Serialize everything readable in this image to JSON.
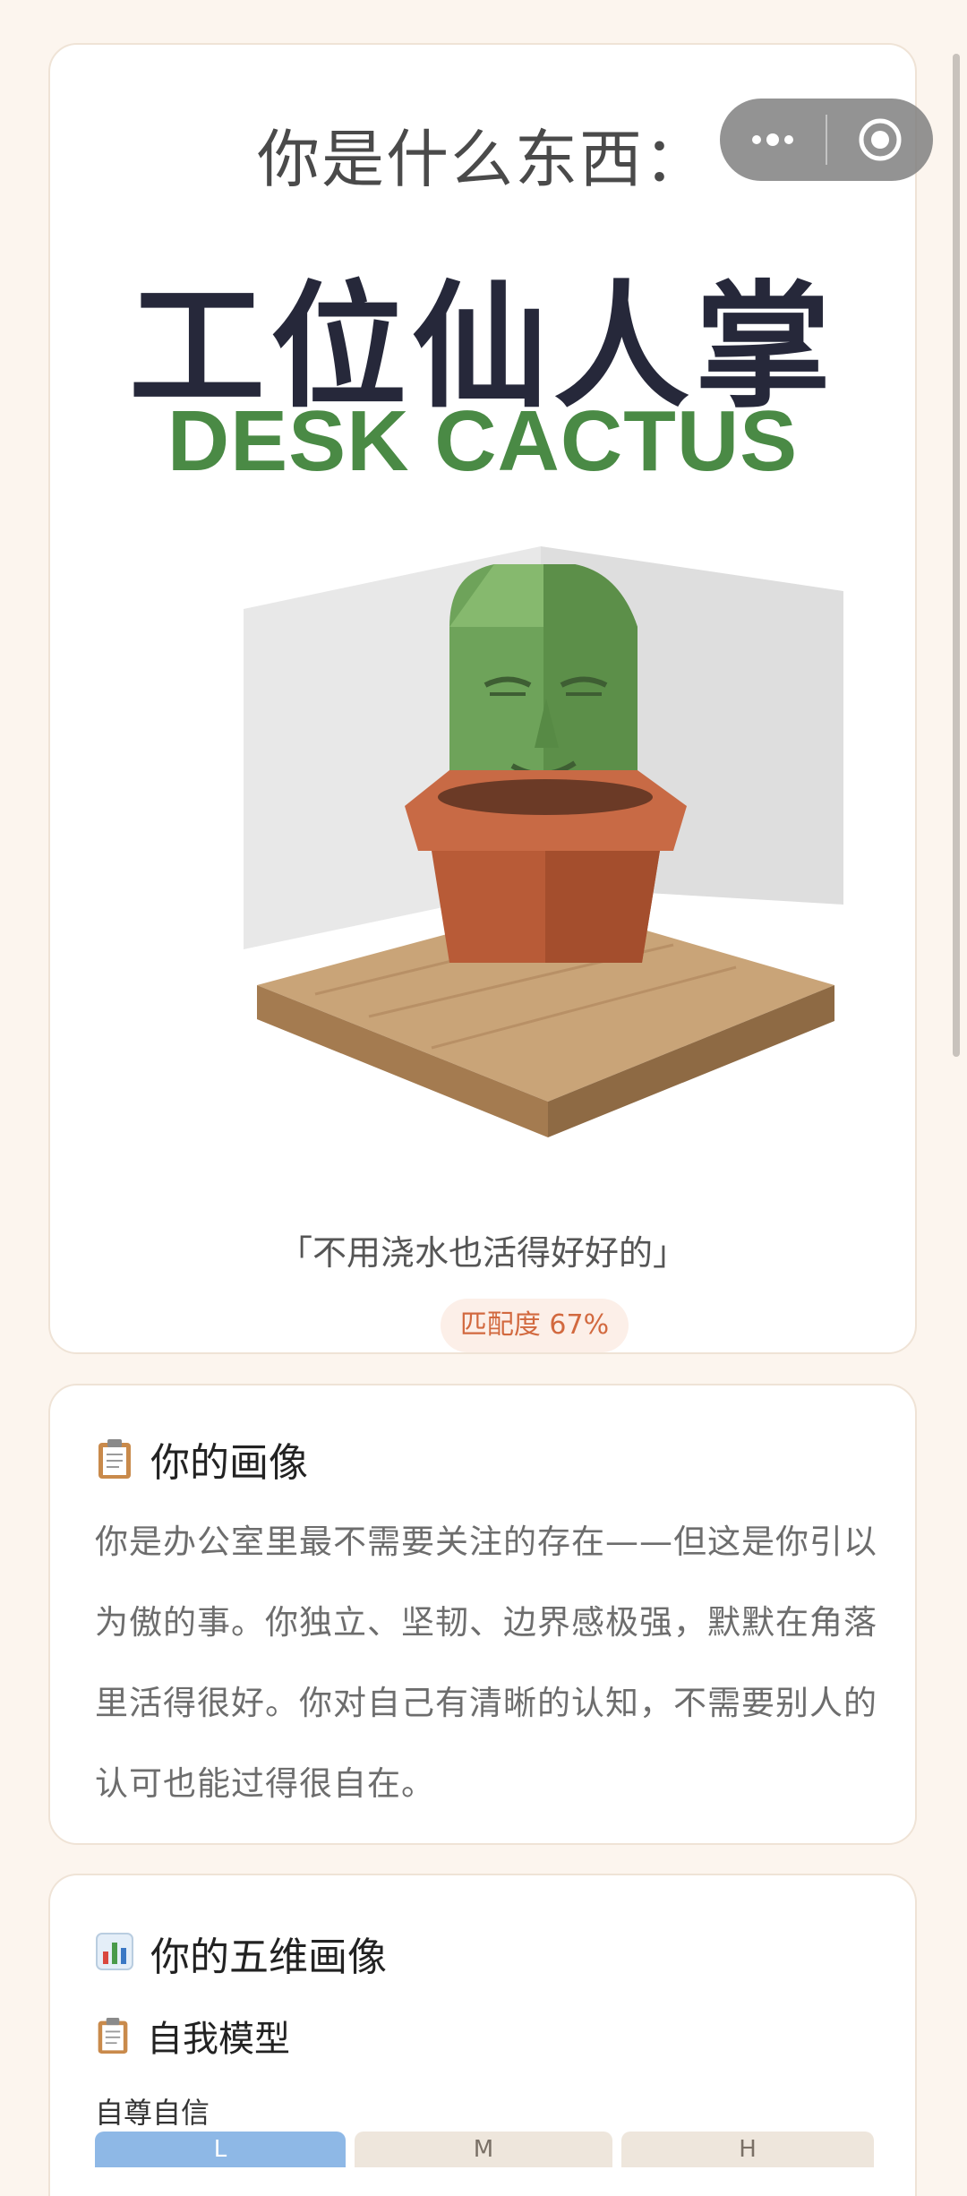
{
  "result_card": {
    "question": "你是什么东西：",
    "title_cn": "工位仙人掌",
    "title_en": "DESK CACTUS",
    "quote": "「不用浇水也活得好好的」",
    "match_label": "匹配度 67%",
    "match_percent": 67
  },
  "portrait": {
    "icon": "clipboard-icon",
    "title": "你的画像",
    "body": "你是办公室里最不需要关注的存在——但这是你引以为傲的事。你独立、坚韧、边界感极强，默默在角落里活得很好。你对自己有清晰的认知，不需要别人的认可也能过得很自在。"
  },
  "dimensions": {
    "icon": "bar-chart-icon",
    "title": "你的五维画像",
    "sub_icon": "clipboard-icon",
    "sub_title": "自我模型",
    "first_label": "自尊自信",
    "levels": [
      "L",
      "M",
      "H"
    ],
    "selected_level": "L"
  },
  "capsule": {
    "more_icon": "more-dots-icon",
    "close_icon": "target-circle-icon"
  },
  "colors": {
    "page_bg": "#fcf5ee",
    "accent_green": "#4a8a45",
    "accent_orange": "#d2693f",
    "title_dark": "#26283a",
    "level_active": "#8eb8e6"
  }
}
